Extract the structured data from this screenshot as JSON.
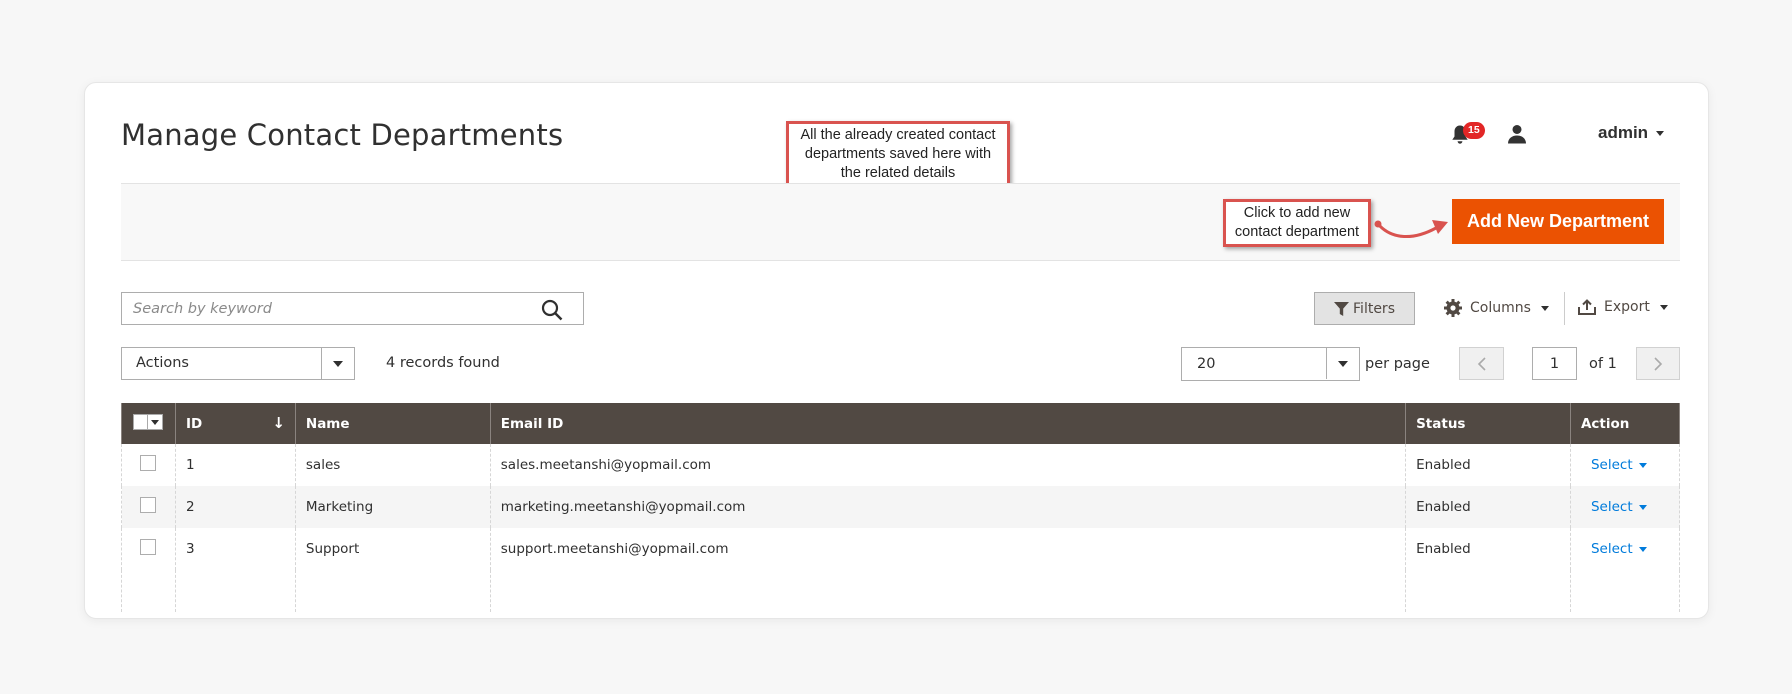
{
  "page": {
    "title": "Manage Contact Departments"
  },
  "callouts": {
    "top": "All the already created contact\ndepartments saved here with\nthe related details",
    "add": "Click to add new\ncontact department"
  },
  "header": {
    "notifications_count": "15",
    "user_name": "admin"
  },
  "actionbar": {
    "add_label": "Add New Department"
  },
  "toolbar": {
    "search_placeholder": "Search by keyword",
    "filters_label": "Filters",
    "columns_label": "Columns",
    "export_label": "Export",
    "actions_label": "Actions",
    "records_found": "4 records found",
    "per_page_value": "20",
    "per_page_label": "per page",
    "current_page": "1",
    "page_of": "of 1"
  },
  "grid": {
    "columns": [
      "ID",
      "Name",
      "Email ID",
      "Status",
      "Action"
    ],
    "rows": [
      {
        "id": "1",
        "name": "sales",
        "email": "sales.meetanshi@yopmail.com",
        "status": "Enabled",
        "action": "Select"
      },
      {
        "id": "2",
        "name": "Marketing",
        "email": "marketing.meetanshi@yopmail.com",
        "status": "Enabled",
        "action": "Select"
      },
      {
        "id": "3",
        "name": "Support",
        "email": "support.meetanshi@yopmail.com",
        "status": "Enabled",
        "action": "Select"
      }
    ]
  },
  "colors": {
    "accent": "#eb5202",
    "header_bg": "#514943",
    "link": "#007bdb",
    "callout_border": "#d9534f",
    "badge": "#e22626"
  },
  "icons": [
    "bell-icon",
    "user-icon",
    "search-icon",
    "filter-icon",
    "gear-icon",
    "export-icon",
    "chevron-left-icon",
    "chevron-right-icon",
    "sort-down-icon"
  ]
}
